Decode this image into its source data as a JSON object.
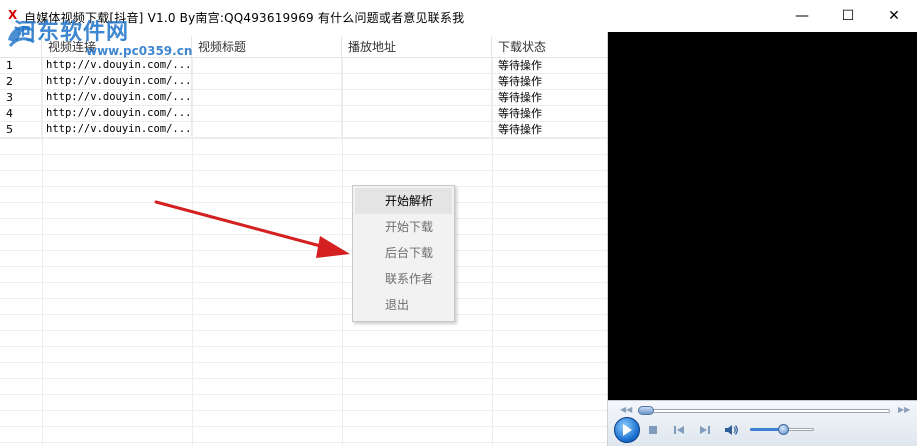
{
  "window": {
    "title": "自媒体视频下载[抖音] V1.0   By南宫:QQ493619969  有什么问题或者意见联系我",
    "app_icon_glyph": "X",
    "minimize_glyph": "—",
    "maximize_glyph": "☐",
    "close_glyph": "✕"
  },
  "watermark": {
    "text": "河东软件网",
    "url": "www.pc0359.cn"
  },
  "table": {
    "headers": [
      "",
      "视频连接",
      "视频标题",
      "播放地址",
      "下载状态"
    ],
    "rows": [
      {
        "index": "1",
        "link": "http://v.douyin.com/...",
        "title": "",
        "play_url": "",
        "status": "等待操作"
      },
      {
        "index": "2",
        "link": "http://v.douyin.com/...",
        "title": "",
        "play_url": "",
        "status": "等待操作"
      },
      {
        "index": "3",
        "link": "http://v.douyin.com/...",
        "title": "",
        "play_url": "",
        "status": "等待操作"
      },
      {
        "index": "4",
        "link": "http://v.douyin.com/...",
        "title": "",
        "play_url": "",
        "status": "等待操作"
      },
      {
        "index": "5",
        "link": "http://v.douyin.com/...",
        "title": "",
        "play_url": "",
        "status": "等待操作"
      }
    ]
  },
  "context_menu": {
    "items": [
      "开始解析",
      "开始下载",
      "后台下载",
      "联系作者",
      "退出"
    ],
    "active_index": 0
  },
  "player": {
    "seek_position": 0.0,
    "volume": 0.5
  },
  "colors": {
    "arrow": "#d42020",
    "watermark": "#1e73c8",
    "player_bg": "#000000"
  }
}
